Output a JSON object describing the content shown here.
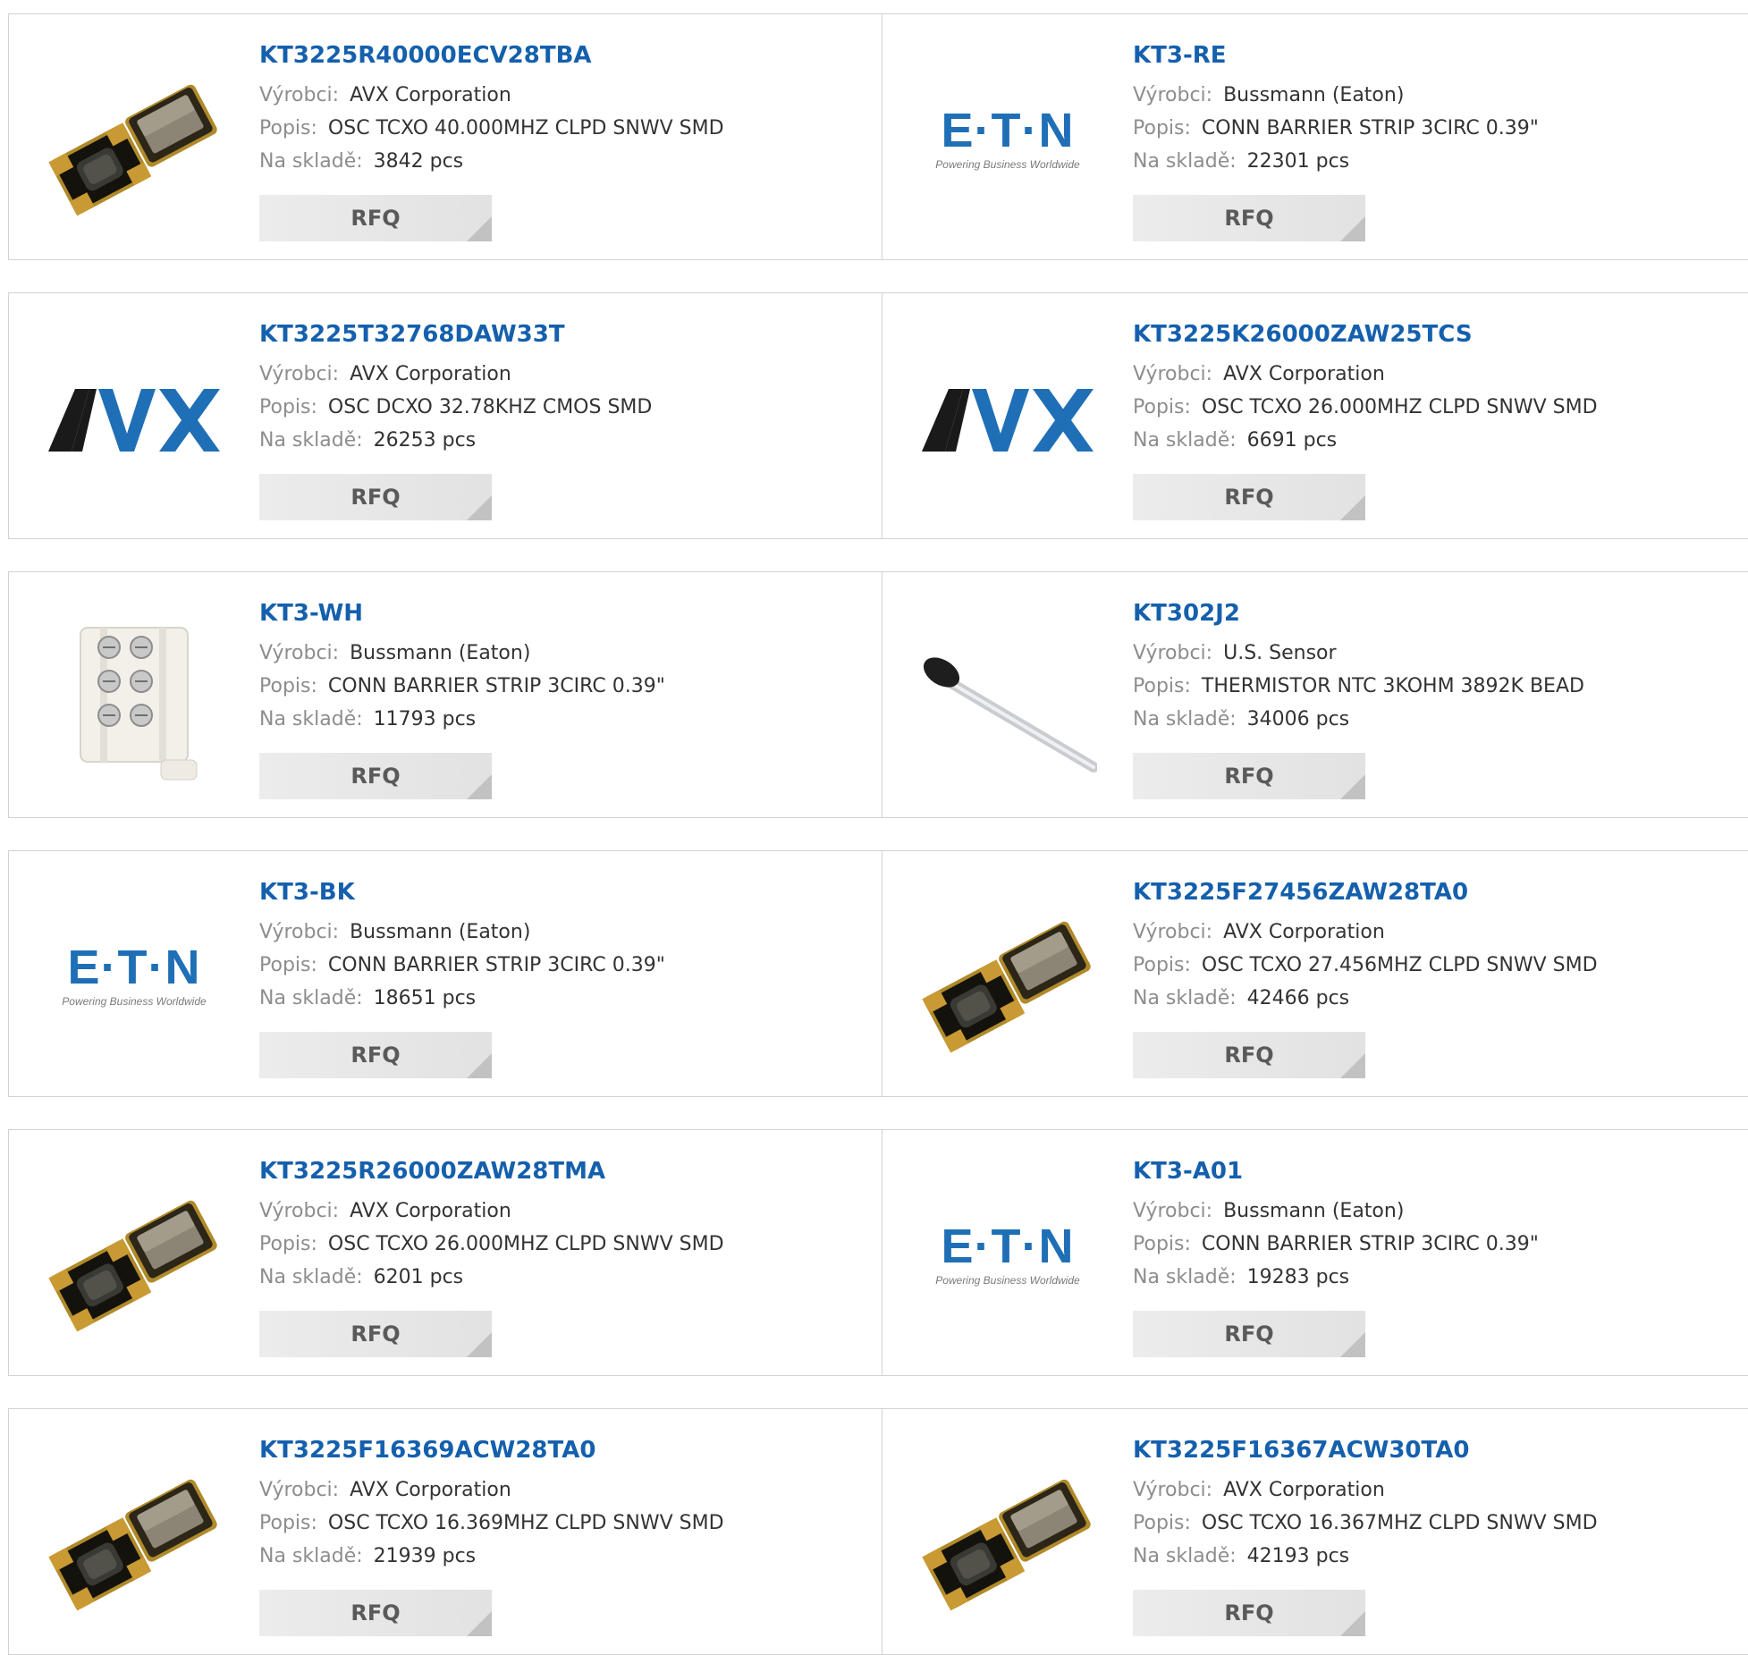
{
  "labels": {
    "manufacturer": "Výrobci:",
    "description": "Popis:",
    "stock": "Na skladě:",
    "rfq": "RFQ"
  },
  "brand_logos": {
    "eaton_tagline": "Powering Business Worldwide"
  },
  "products": [
    {
      "part_number": "KT3225R40000ECV28TBA",
      "manufacturer": "AVX Corporation",
      "description": "OSC TCXO 40.000MHZ CLPD SNWV SMD",
      "stock": "3842 pcs",
      "image": "smd-oscillator-icon"
    },
    {
      "part_number": "KT3-RE",
      "manufacturer": "Bussmann (Eaton)",
      "description": "CONN BARRIER STRIP 3CIRC 0.39\"",
      "stock": "22301 pcs",
      "image": "eaton-logo-icon"
    },
    {
      "part_number": "KT3225T32768DAW33T",
      "manufacturer": "AVX Corporation",
      "description": "OSC DCXO 32.78KHZ CMOS SMD",
      "stock": "26253 pcs",
      "image": "avx-logo-icon"
    },
    {
      "part_number": "KT3225K26000ZAW25TCS",
      "manufacturer": "AVX Corporation",
      "description": "OSC TCXO 26.000MHZ CLPD SNWV SMD",
      "stock": "6691 pcs",
      "image": "avx-logo-icon"
    },
    {
      "part_number": "KT3-WH",
      "manufacturer": "Bussmann (Eaton)",
      "description": "CONN BARRIER STRIP 3CIRC 0.39\"",
      "stock": "11793 pcs",
      "image": "barrier-strip-icon"
    },
    {
      "part_number": "KT302J2",
      "manufacturer": "U.S. Sensor",
      "description": "THERMISTOR NTC 3KOHM 3892K BEAD",
      "stock": "34006 pcs",
      "image": "thermistor-icon"
    },
    {
      "part_number": "KT3-BK",
      "manufacturer": "Bussmann (Eaton)",
      "description": "CONN BARRIER STRIP 3CIRC 0.39\"",
      "stock": "18651 pcs",
      "image": "eaton-logo-icon"
    },
    {
      "part_number": "KT3225F27456ZAW28TA0",
      "manufacturer": "AVX Corporation",
      "description": "OSC TCXO 27.456MHZ CLPD SNWV SMD",
      "stock": "42466 pcs",
      "image": "smd-oscillator-icon"
    },
    {
      "part_number": "KT3225R26000ZAW28TMA",
      "manufacturer": "AVX Corporation",
      "description": "OSC TCXO 26.000MHZ CLPD SNWV SMD",
      "stock": "6201 pcs",
      "image": "smd-oscillator-icon"
    },
    {
      "part_number": "KT3-A01",
      "manufacturer": "Bussmann (Eaton)",
      "description": "CONN BARRIER STRIP 3CIRC 0.39\"",
      "stock": "19283 pcs",
      "image": "eaton-logo-icon"
    },
    {
      "part_number": "KT3225F16369ACW28TA0",
      "manufacturer": "AVX Corporation",
      "description": "OSC TCXO 16.369MHZ CLPD SNWV SMD",
      "stock": "21939 pcs",
      "image": "smd-oscillator-icon"
    },
    {
      "part_number": "KT3225F16367ACW30TA0",
      "manufacturer": "AVX Corporation",
      "description": "OSC TCXO 16.367MHZ CLPD SNWV SMD",
      "stock": "42193 pcs",
      "image": "smd-oscillator-icon"
    }
  ],
  "colors": {
    "link": "#1560ad",
    "label": "#8d8d8d",
    "border": "#d2d2d2",
    "button_bg": "#e8e8e8"
  }
}
